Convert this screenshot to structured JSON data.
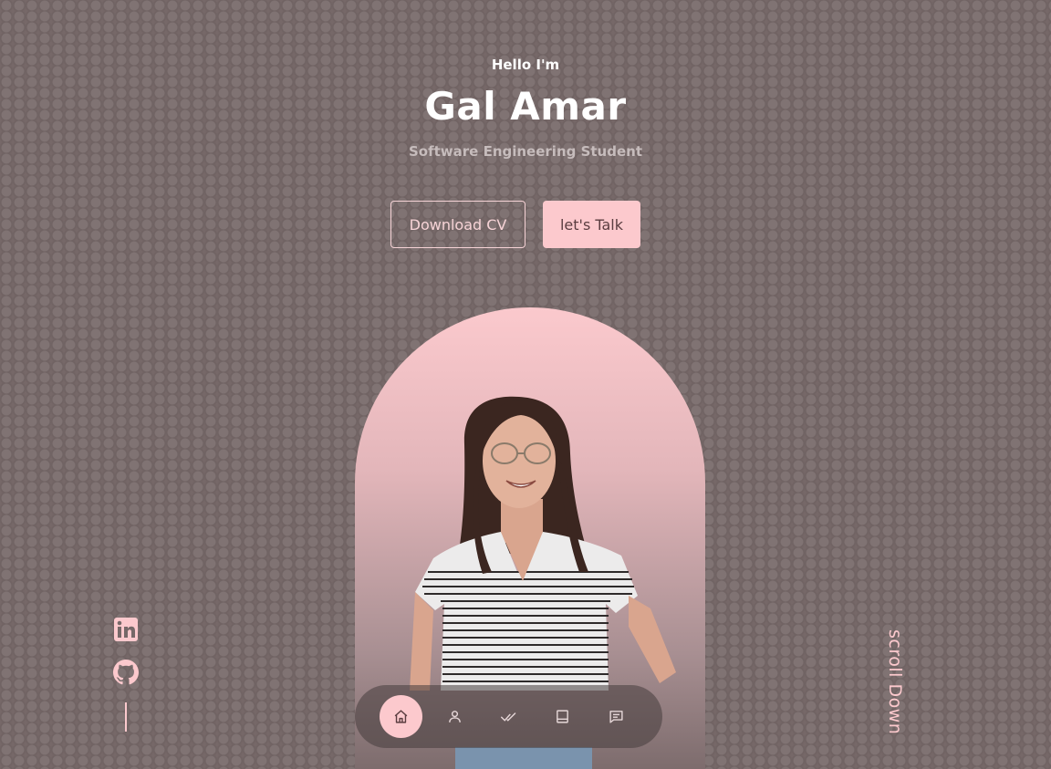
{
  "hero": {
    "greeting": "Hello I'm",
    "name": "Gal Amar",
    "subtitle": "Software Engineering Student"
  },
  "buttons": {
    "download_cv": "Download CV",
    "lets_talk": "let's Talk"
  },
  "social": [
    {
      "icon": "linkedin-icon"
    },
    {
      "icon": "github-icon"
    }
  ],
  "scroll": {
    "label": "scroll Down"
  },
  "nav": {
    "items": [
      {
        "icon": "home-icon",
        "active": true
      },
      {
        "icon": "user-icon",
        "active": false
      },
      {
        "icon": "double-check-icon",
        "active": false
      },
      {
        "icon": "book-icon",
        "active": false
      },
      {
        "icon": "message-icon",
        "active": false
      }
    ]
  },
  "colors": {
    "background": "#766868",
    "accent": "#fcc9cd",
    "text_primary": "#ffffff",
    "text_muted": "#c6bcbc"
  }
}
